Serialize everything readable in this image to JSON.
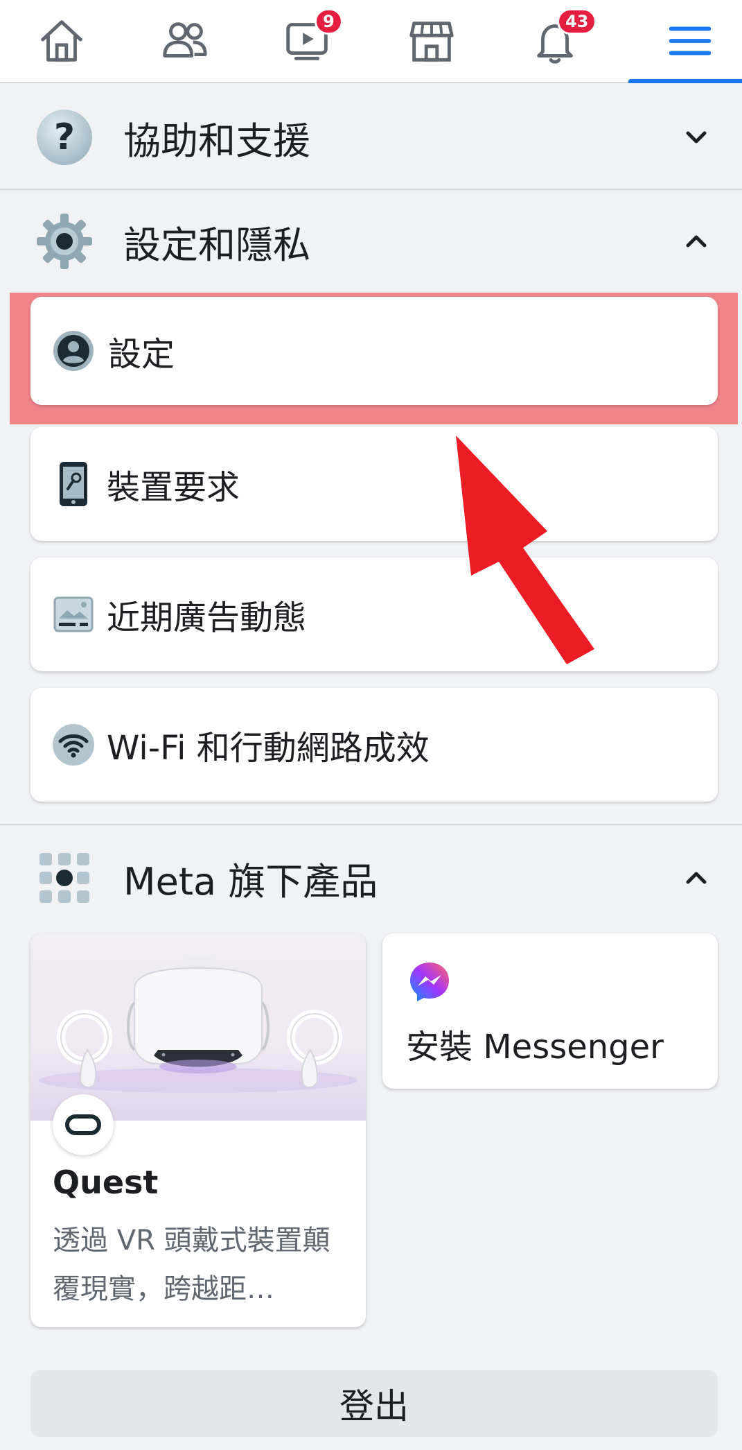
{
  "nav": {
    "video_badge": "9",
    "notifications_badge": "43"
  },
  "sections": {
    "help": {
      "title": "協助和支援"
    },
    "settings_privacy": {
      "title": "設定和隱私",
      "items": [
        {
          "label": "設定"
        },
        {
          "label": "裝置要求"
        },
        {
          "label": "近期廣告動態"
        },
        {
          "label": "Wi-Fi 和行動網路成效"
        }
      ]
    },
    "meta_products": {
      "title": "Meta 旗下產品",
      "quest": {
        "title": "Quest",
        "description": "透過 VR 頭戴式裝置顛覆現實，跨越距…"
      },
      "messenger": {
        "label": "安裝 Messenger"
      }
    }
  },
  "logout": {
    "label": "登出"
  },
  "colors": {
    "accent": "#1877f2",
    "badge": "#e41e3f",
    "highlight": "#f05a5f",
    "arrow": "#ed1c24"
  }
}
